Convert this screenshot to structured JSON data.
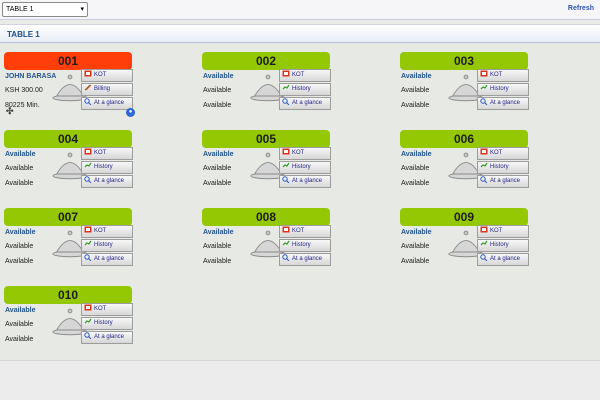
{
  "toolbar": {
    "selected_table": "TABLE 1",
    "refresh_label": "Refresh"
  },
  "panel": {
    "title": "TABLE 1"
  },
  "tables": [
    {
      "number": "001",
      "line1": "JOHN BARASA",
      "line2": "KSH 300.00",
      "line3": "80225 Min.",
      "btn1": "KOT",
      "btn2": "Billing",
      "btn3": "At a glance",
      "status": "occupied"
    },
    {
      "number": "002",
      "line1": "Available",
      "line2": "Available",
      "line3": "Available",
      "btn1": "KOT",
      "btn2": "History",
      "btn3": "At a glance",
      "status": "available"
    },
    {
      "number": "003",
      "line1": "Available",
      "line2": "Available",
      "line3": "Available",
      "btn1": "KOT",
      "btn2": "History",
      "btn3": "At a glance",
      "status": "available"
    },
    {
      "number": "004",
      "line1": "Available",
      "line2": "Available",
      "line3": "Available",
      "btn1": "KOT",
      "btn2": "History",
      "btn3": "At a glance",
      "status": "available"
    },
    {
      "number": "005",
      "line1": "Available",
      "line2": "Available",
      "line3": "Available",
      "btn1": "KOT",
      "btn2": "History",
      "btn3": "At a glance",
      "status": "available"
    },
    {
      "number": "006",
      "line1": "Available",
      "line2": "Available",
      "line3": "Available",
      "btn1": "KOT",
      "btn2": "History",
      "btn3": "At a glance",
      "status": "available"
    },
    {
      "number": "007",
      "line1": "Available",
      "line2": "Available",
      "line3": "Available",
      "btn1": "KOT",
      "btn2": "History",
      "btn3": "At a glance",
      "status": "available"
    },
    {
      "number": "008",
      "line1": "Available",
      "line2": "Available",
      "line3": "Available",
      "btn1": "KOT",
      "btn2": "History",
      "btn3": "At a glance",
      "status": "available"
    },
    {
      "number": "009",
      "line1": "Available",
      "line2": "Available",
      "line3": "Available",
      "btn1": "KOT",
      "btn2": "History",
      "btn3": "At a glance",
      "status": "available"
    },
    {
      "number": "010",
      "line1": "Available",
      "line2": "Available",
      "line3": "Available",
      "btn1": "KOT",
      "btn2": "History",
      "btn3": "At a glance",
      "status": "available"
    }
  ],
  "colors": {
    "available_header": "#93c802",
    "occupied_header": "#ff3e0a",
    "link_blue": "#2f55b3"
  }
}
